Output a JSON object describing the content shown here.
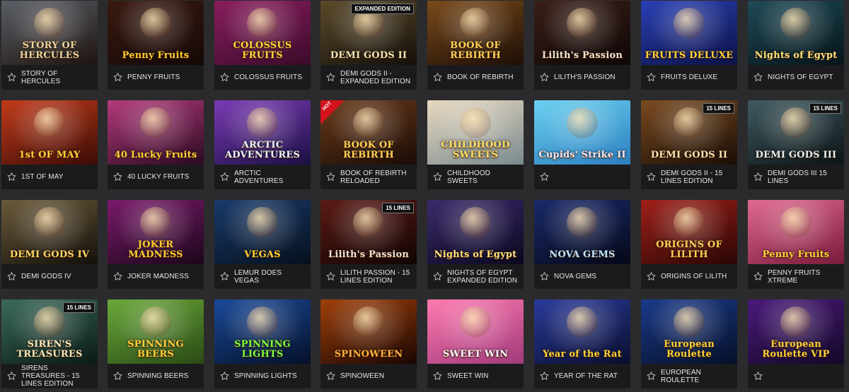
{
  "games": [
    {
      "title": "STORY OF HERCULES",
      "logo": "STORY OF HERCULES",
      "bg1": "#5a5e66",
      "bg2": "#1e1410",
      "accent": "#e9d3a0"
    },
    {
      "title": "PENNY FRUITS",
      "logo": "Penny Fruits",
      "bg1": "#3a1a10",
      "bg2": "#140806",
      "accent": "#ffcc33"
    },
    {
      "title": "COLOSSUS FRUITS",
      "logo": "COLOSSUS FRUITS",
      "bg1": "#8a1d5e",
      "bg2": "#3b0b2a",
      "accent": "#ffd43b"
    },
    {
      "title": "DEMI GODS II - EXPANDED EDITION",
      "logo": "DEMI GODS II",
      "badge": "EXPANDED EDITION",
      "bg1": "#5a4a2a",
      "bg2": "#15100a",
      "accent": "#f0e2b4"
    },
    {
      "title": "BOOK OF REBIRTH",
      "logo": "BOOK OF REBIRTH",
      "bg1": "#7a4a1a",
      "bg2": "#1c0e06",
      "accent": "#ffd05a"
    },
    {
      "title": "LILITH'S PASSION",
      "logo": "Lilith's Passion",
      "bg1": "#3a1e18",
      "bg2": "#0e0706",
      "accent": "#f2e2d0"
    },
    {
      "title": "FRUITS DELUXE",
      "logo": "FRUITS DELUXE",
      "bg1": "#2a3fb5",
      "bg2": "#0c1244",
      "accent": "#ffd23a"
    },
    {
      "title": "NIGHTS OF EGYPT",
      "logo": "Nights of Egypt",
      "bg1": "#1f4a55",
      "bg2": "#07141a",
      "accent": "#ffe07a"
    },
    {
      "title": "1ST OF MAY",
      "logo": "1st OF MAY",
      "bg1": "#c23a1a",
      "bg2": "#3b0c06",
      "accent": "#ffd23a"
    },
    {
      "title": "40 LUCKY FRUITS",
      "logo": "40 Lucky Fruits",
      "bg1": "#b43a7a",
      "bg2": "#2a0a22",
      "accent": "#ffd23a"
    },
    {
      "title": "ARCTIC ADVENTURES",
      "logo": "ARCTIC ADVENTURES",
      "bg1": "#7a3ab5",
      "bg2": "#1c1044",
      "accent": "#e8f6ff"
    },
    {
      "title": "BOOK OF REBIRTH RELOADED",
      "logo": "BOOK OF REBIRTH",
      "hot": "HOT",
      "bg1": "#6a3a1a",
      "bg2": "#1a0c06",
      "accent": "#ffd05a"
    },
    {
      "title": "CHILDHOOD SWEETS",
      "logo": "CHILDHOOD SWEETS",
      "bg1": "#e8d9c0",
      "bg2": "#7a8a8f",
      "accent": "#ffe066"
    },
    {
      "title": "",
      "logo": "Cupids' Strike II",
      "bg1": "#6ad0f0",
      "bg2": "#2c7fc0",
      "accent": "#ffe6f0"
    },
    {
      "title": "DEMI GODS II - 15 LINES EDITION",
      "logo": "DEMI GODS II",
      "badge": "15 LINES",
      "bg1": "#7a4a20",
      "bg2": "#1a0e06",
      "accent": "#f5e2b0"
    },
    {
      "title": "DEMI GODS III 15 LINES",
      "logo": "DEMI GODS III",
      "badge": "15 LINES",
      "bg1": "#3f5a60",
      "bg2": "#0c1416",
      "accent": "#e7eef0"
    },
    {
      "title": "DEMI GODS IV",
      "logo": "DEMI GODS IV",
      "bg1": "#6a5a3a",
      "bg2": "#14100a",
      "accent": "#ffd66a"
    },
    {
      "title": "JOKER MADNESS",
      "logo": "JOKER MADNESS",
      "bg1": "#7a1a6a",
      "bg2": "#1c061a",
      "accent": "#ffcc33"
    },
    {
      "title": "LEMUR DOES VEGAS",
      "logo": "VEGAS",
      "bg1": "#1a3a6a",
      "bg2": "#06101e",
      "accent": "#ffd23a"
    },
    {
      "title": "LILITH PASSION - 15 LINES EDITION",
      "logo": "Lilith's Passion",
      "badge": "15 LINES",
      "bg1": "#5a1a14",
      "bg2": "#120504",
      "accent": "#f2e2d0"
    },
    {
      "title": "NIGHTS OF EGYPT EXPANDED EDITION",
      "logo": "Nights of Egypt",
      "bg1": "#3a2a6a",
      "bg2": "#0c0820",
      "accent": "#ffe07a"
    },
    {
      "title": "NOVA GEMS",
      "logo": "NOVA GEMS",
      "bg1": "#1a2a6a",
      "bg2": "#050818",
      "accent": "#bfe6ff"
    },
    {
      "title": "ORIGINS OF LILITH",
      "logo": "ORIGINS OF LILITH",
      "bg1": "#a0201a",
      "bg2": "#2a0604",
      "accent": "#ffd05a"
    },
    {
      "title": "PENNY FRUITS XTREME",
      "logo": "Penny Fruits",
      "bg1": "#e06a90",
      "bg2": "#7a1a3a",
      "accent": "#ffd23a"
    },
    {
      "title": "SIRENS TREASURES - 15 LINES EDITION",
      "logo": "SIREN'S TREASURES",
      "badge": "15 LINES",
      "bg1": "#3a6a5a",
      "bg2": "#0a1a14",
      "accent": "#f0e6c0"
    },
    {
      "title": "SPINNING BEERS",
      "logo": "SPINNING BEERS",
      "bg1": "#6aa83a",
      "bg2": "#2a4a14",
      "accent": "#ffd23a"
    },
    {
      "title": "SPINNING LIGHTS",
      "logo": "SPINNING LIGHTS",
      "bg1": "#1a4a9a",
      "bg2": "#051028",
      "accent": "#7dff3a"
    },
    {
      "title": "SPINOWEEN",
      "logo": "SPINOWEEN",
      "bg1": "#a0400a",
      "bg2": "#1a0602",
      "accent": "#ffb23a"
    },
    {
      "title": "SWEET WIN",
      "logo": "SWEET WIN",
      "bg1": "#ff7ab0",
      "bg2": "#a03a7a",
      "accent": "#ffffff"
    },
    {
      "title": "YEAR OF THE RAT",
      "logo": "Year of the Rat",
      "bg1": "#2a3a9a",
      "bg2": "#0a0f2e",
      "accent": "#ffd23a"
    },
    {
      "title": "EUROPEAN ROULETTE",
      "logo": "European Roulette",
      "bg1": "#1a3a8a",
      "bg2": "#061028",
      "accent": "#ffd23a"
    },
    {
      "title": "",
      "logo": "European Roulette VIP",
      "bg1": "#4a1a7a",
      "bg2": "#140828",
      "accent": "#ffd23a"
    }
  ],
  "colors": {
    "page_bg": "#2b2b2d",
    "card_bg": "#1b1b1d",
    "text": "#e7e7e7",
    "star": "#bdbdbd"
  },
  "icons": {
    "favorite": "star-outline-icon"
  }
}
